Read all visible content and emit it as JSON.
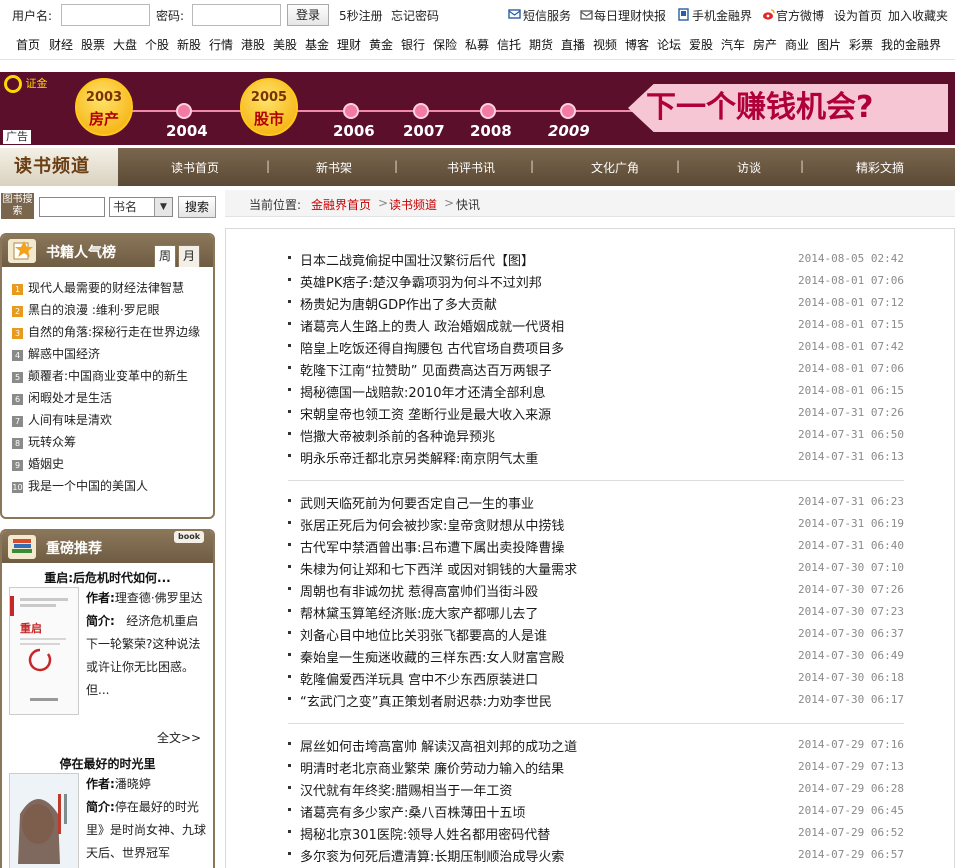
{
  "login": {
    "username_label": "用户名:",
    "password_label": "密码:",
    "login_button": "登录",
    "register_link": "5秒注册",
    "forgot_link": "忘记密码",
    "links": [
      "短信服务",
      "每日理财快报",
      "手机金融界",
      "官方微博",
      "设为首页",
      "加入收藏夹"
    ]
  },
  "main_nav": [
    "首页",
    "财经",
    "股票",
    "大盘",
    "个股",
    "新股",
    "行情",
    "港股",
    "美股",
    "基金",
    "理财",
    "黄金",
    "银行",
    "保险",
    "私募",
    "信托",
    "期货",
    "直播",
    "视频",
    "博客",
    "论坛",
    "爱股",
    "汽车",
    "房产",
    "商业",
    "图片",
    "彩票",
    "我的金融界"
  ],
  "banner": {
    "ad_label": "广告",
    "logo_text": "证金",
    "years": [
      "2004",
      "2006",
      "2007",
      "2008",
      "2009"
    ],
    "badges": [
      {
        "year": "2003",
        "text": "房产"
      },
      {
        "year": "2005",
        "text": "股市"
      }
    ],
    "slogan": "下一个赚钱机会?"
  },
  "channel": {
    "title": "读书频道",
    "items": [
      "读书首页",
      "新书架",
      "书评书讯",
      "文化广角",
      "访谈",
      "精彩文摘"
    ]
  },
  "search": {
    "icon_text": "图书搜索",
    "field_option": "书名",
    "button": "搜索"
  },
  "breadcrumb": {
    "prefix": "当前位置:",
    "home": "金融界首页",
    "channel": "读书频道",
    "current": "快讯"
  },
  "ranking": {
    "title": "书籍人气榜",
    "tab_week": "周",
    "tab_month": "月",
    "items": [
      "现代人最需要的财经法律智慧",
      "黑白的浪漫 :维利·罗尼眼",
      "自然的角落:探秘行走在世界边缘",
      "解惑中国经济",
      "颠覆者:中国商业变革中的新生",
      "闲暇处才是生活",
      "人间有味是清欢",
      "玩转众筹",
      "婚姻史",
      "我是一个中国的美国人"
    ]
  },
  "recommend": {
    "title": "重磅推荐",
    "tag": "book",
    "book1": {
      "title": "重启:后危机时代如何...",
      "author_label": "作者:",
      "author": "理查德·佛罗里达",
      "intro_label": "简介:",
      "intro": "经济危机重启下一轮繁荣?这种说法或许让你无比困惑。但...",
      "more": "全文>>"
    },
    "book2": {
      "title": "停在最好的时光里",
      "author_label": "作者:",
      "author": "潘晓婷",
      "intro_label": "简介:",
      "intro": "停在最好的时光里》是时尚女神、九球天后、世界冠军"
    }
  },
  "news_groups": [
    [
      {
        "title": "日本二战竟偷捉中国壮汉繁衍后代【图】",
        "date": "2014-08-05 02:42"
      },
      {
        "title": "英雄PK痞子:楚汉争霸项羽为何斗不过刘邦",
        "date": "2014-08-01 07:06"
      },
      {
        "title": "杨贵妃为唐朝GDP作出了多大贡献",
        "date": "2014-08-01 07:12"
      },
      {
        "title": "诸葛亮人生路上的贵人 政治婚姻成就一代贤相",
        "date": "2014-08-01 07:15"
      },
      {
        "title": "陪皇上吃饭还得自掏腰包 古代官场自费项目多",
        "date": "2014-08-01 07:42"
      },
      {
        "title": "乾隆下江南“拉赞助” 见面费高达百万两银子",
        "date": "2014-08-01 07:06"
      },
      {
        "title": "揭秘德国一战赔款:2010年才还清全部利息",
        "date": "2014-08-01 06:15"
      },
      {
        "title": "宋朝皇帝也领工资 垄断行业是最大收入来源",
        "date": "2014-07-31 07:26"
      },
      {
        "title": "恺撒大帝被刺杀前的各种诡异预兆",
        "date": "2014-07-31 06:50"
      },
      {
        "title": "明永乐帝迁都北京另类解释:南京阴气太重",
        "date": "2014-07-31 06:13"
      }
    ],
    [
      {
        "title": "武则天临死前为何要否定自己一生的事业",
        "date": "2014-07-31 06:23"
      },
      {
        "title": "张居正死后为何会被抄家:皇帝贪财想从中捞钱",
        "date": "2014-07-31 06:19"
      },
      {
        "title": "古代军中禁酒曾出事:吕布遭下属出卖投降曹操",
        "date": "2014-07-31 06:40"
      },
      {
        "title": "朱棣为何让郑和七下西洋 或因对铜钱的大量需求",
        "date": "2014-07-30 07:10"
      },
      {
        "title": "周朝也有非诚勿扰 惹得高富帅们当街斗殴",
        "date": "2014-07-30 07:26"
      },
      {
        "title": "帮林黛玉算笔经济账:庞大家产都哪儿去了",
        "date": "2014-07-30 07:23"
      },
      {
        "title": "刘备心目中地位比关羽张飞都要高的人是谁",
        "date": "2014-07-30 06:37"
      },
      {
        "title": "秦始皇一生痴迷收藏的三样东西:女人财富宫殿",
        "date": "2014-07-30 06:49"
      },
      {
        "title": "乾隆偏爱西洋玩具 宫中不少东西原装进口",
        "date": "2014-07-30 06:18"
      },
      {
        "title": "“玄武门之变”真正策划者尉迟恭:力劝李世民",
        "date": "2014-07-30 06:17"
      }
    ],
    [
      {
        "title": "屌丝如何击垮高富帅 解读汉高祖刘邦的成功之道",
        "date": "2014-07-29 07:16"
      },
      {
        "title": "明清时老北京商业繁荣 廉价劳动力输入的结果",
        "date": "2014-07-29 07:13"
      },
      {
        "title": "汉代就有年终奖:腊赐相当于一年工资",
        "date": "2014-07-29 06:28"
      },
      {
        "title": "诸葛亮有多少家产:桑八百株薄田十五顷",
        "date": "2014-07-29 06:45"
      },
      {
        "title": "揭秘北京301医院:领导人姓名都用密码代替",
        "date": "2014-07-29 06:52"
      },
      {
        "title": "多尔衮为何死后遭清算:长期压制顺治成导火索",
        "date": "2014-07-29 06:57"
      }
    ]
  ],
  "colors": {
    "banner_bg": "#5b0f2a",
    "channel_bar": "#6e5c43",
    "link_red": "#c60000"
  }
}
